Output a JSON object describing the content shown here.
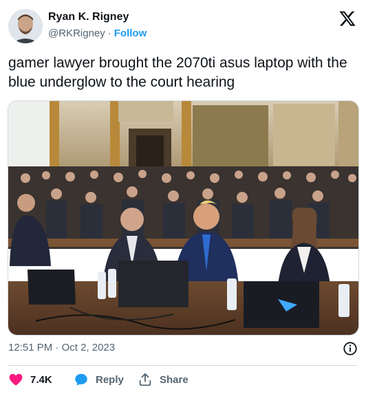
{
  "author": {
    "name": "Ryan K. Rigney",
    "handle": "@RKRigney",
    "separator": "·",
    "follow_label": "Follow"
  },
  "tweet": {
    "text": "gamer lawyer brought the 2070ti asus laptop with the blue underglow to the court hearing"
  },
  "timestamp": {
    "time": "12:51 PM",
    "separator": "·",
    "date": "Oct 2, 2023"
  },
  "actions": {
    "like_count": "7.4K",
    "reply_label": "Reply",
    "share_label": "Share"
  },
  "colors": {
    "accent": "#1d9bf0",
    "like": "#f91880",
    "text": "#0f1419",
    "muted": "#536471"
  },
  "icons": [
    "x-logo-icon",
    "info-icon",
    "heart-icon",
    "reply-bubble-icon",
    "share-icon"
  ]
}
